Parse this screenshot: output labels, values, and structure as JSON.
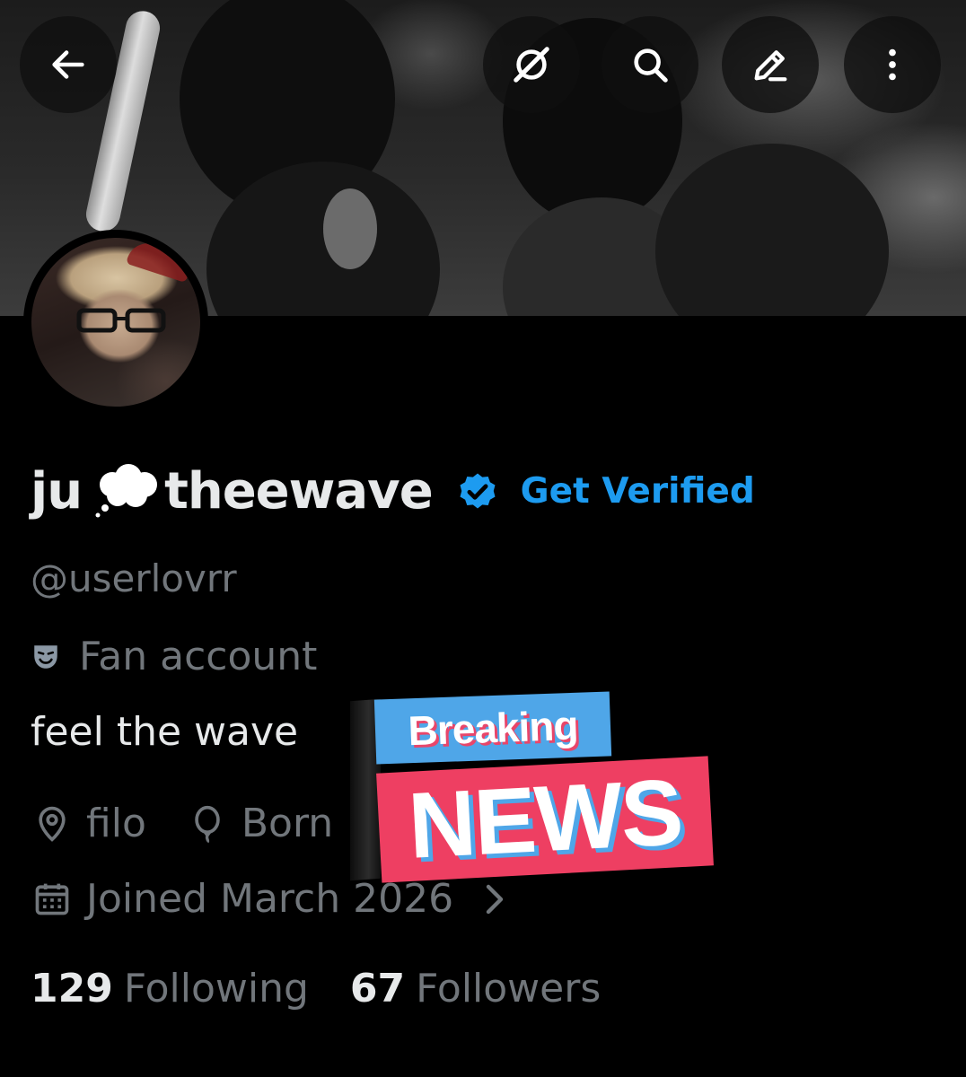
{
  "profile": {
    "display_name_first": "ju",
    "display_name_second": "theewave",
    "get_verified_label": "Get Verified",
    "handle": "@userlovrr",
    "category": "Fan account",
    "bio": "feel the wave",
    "location": "filo",
    "born": "Born",
    "joined": "Joined March 2026",
    "following_count": "129",
    "following_label": "Following",
    "followers_count": "67",
    "followers_label": "Followers"
  },
  "sticker": {
    "top": "Breaking",
    "bottom": "NEWS"
  },
  "toolbar": {
    "icons": [
      "back-arrow-icon",
      "grok-icon",
      "search-icon",
      "edit-icon",
      "more-icon"
    ]
  },
  "colors": {
    "background": "#000000",
    "accent": "#1d9bf0",
    "muted_text": "#71767b",
    "primary_text": "#e7e9ea",
    "sticker_blue": "#4fa6e8",
    "sticker_pink": "#ee3f62"
  }
}
